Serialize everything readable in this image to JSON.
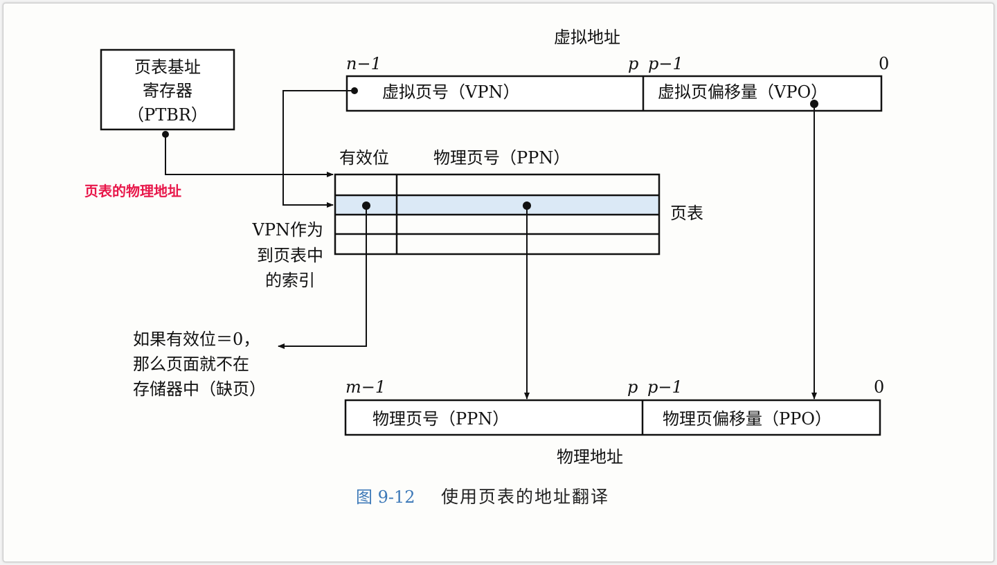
{
  "ptbr": {
    "line1": "页表基址",
    "line2": "寄存器",
    "line3": "（PTBR）"
  },
  "ptbr_note": "页表的物理地址",
  "virtual_address": {
    "title": "虚拟地址",
    "bit_high": "n−1",
    "bit_p": "p",
    "bit_p_minus_1": "p−1",
    "bit_low": "0",
    "vpn": "虚拟页号（VPN）",
    "vpo": "虚拟页偏移量（VPO）"
  },
  "page_table": {
    "valid_header": "有效位",
    "ppn_header": "物理页号（PPN）",
    "label": "页表",
    "row_count": 4,
    "highlight_color": "#dbe9f6"
  },
  "vpn_index_note": {
    "line1": "VPN作为",
    "line2": "到页表中",
    "line3": "的索引"
  },
  "fault_note": {
    "line1": "如果有效位＝0，",
    "line2": "那么页面就不在",
    "line3": "存储器中（缺页）"
  },
  "physical_address": {
    "title": "物理地址",
    "bit_high": "m−1",
    "bit_p": "p",
    "bit_p_minus_1": "p−1",
    "bit_low": "0",
    "ppn": "物理页号（PPN）",
    "ppo": "物理页偏移量（PPO）"
  },
  "caption": {
    "figure_no": "图 9-12",
    "text": "使用页表的地址翻译"
  },
  "colors": {
    "line": "#111111",
    "note": "#e8174a",
    "figure_no": "#3d79b8"
  }
}
